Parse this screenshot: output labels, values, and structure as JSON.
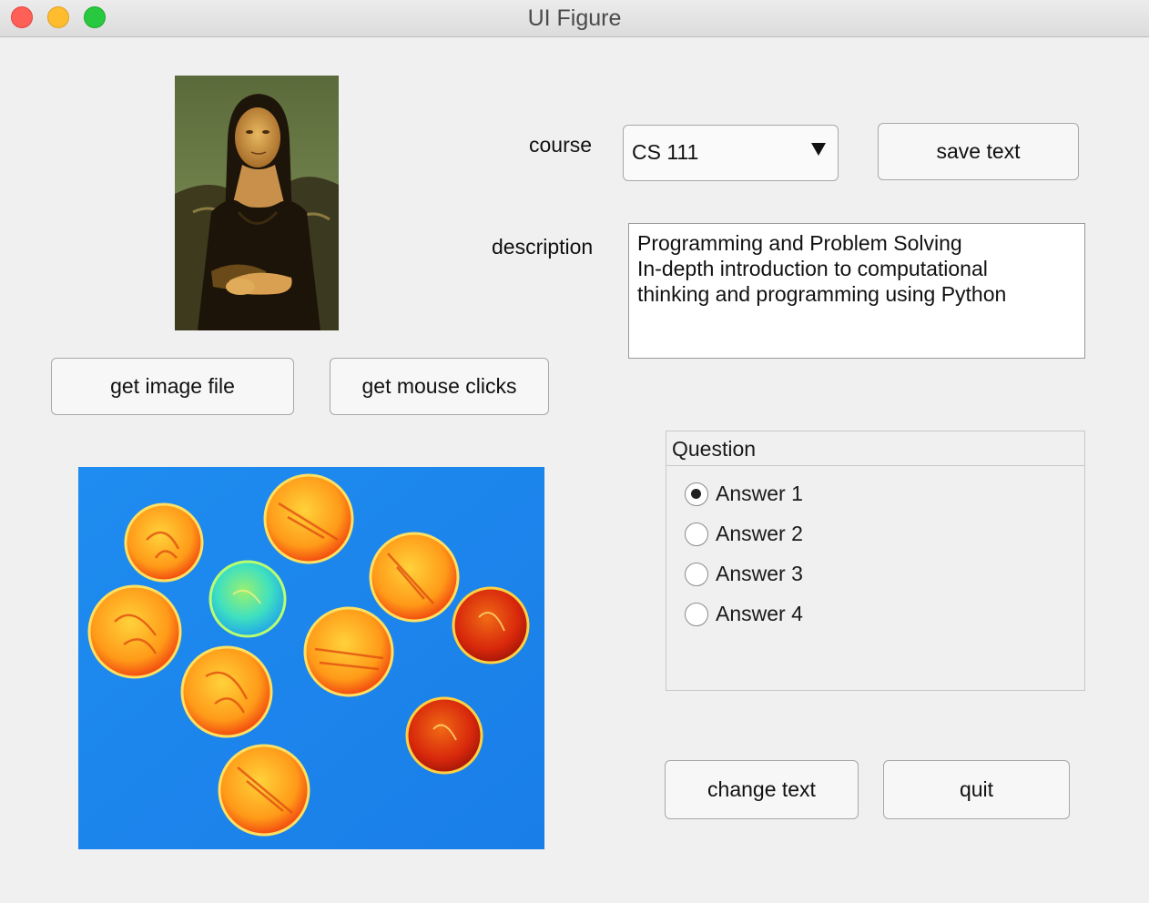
{
  "window": {
    "title": "UI Figure"
  },
  "images": {
    "portrait": "mona-lisa-portrait",
    "coins": "coins-jet-colormap"
  },
  "course": {
    "label": "course",
    "selected": "CS 111"
  },
  "description": {
    "label": "description",
    "lines": [
      "Programming and Problem Solving",
      "",
      "In-depth introduction to computational",
      "thinking and programming using Python"
    ]
  },
  "buttons": {
    "save_text": "save text",
    "get_image_file": "get image file",
    "get_mouse_clicks": "get mouse clicks",
    "change_text": "change text",
    "quit": "quit"
  },
  "question": {
    "title": "Question",
    "answers": [
      "Answer 1",
      "Answer 2",
      "Answer 3",
      "Answer 4"
    ],
    "selected_index": 0
  },
  "colors": {
    "coin_bg": "#1f8ef0",
    "accent": "#28c840"
  }
}
